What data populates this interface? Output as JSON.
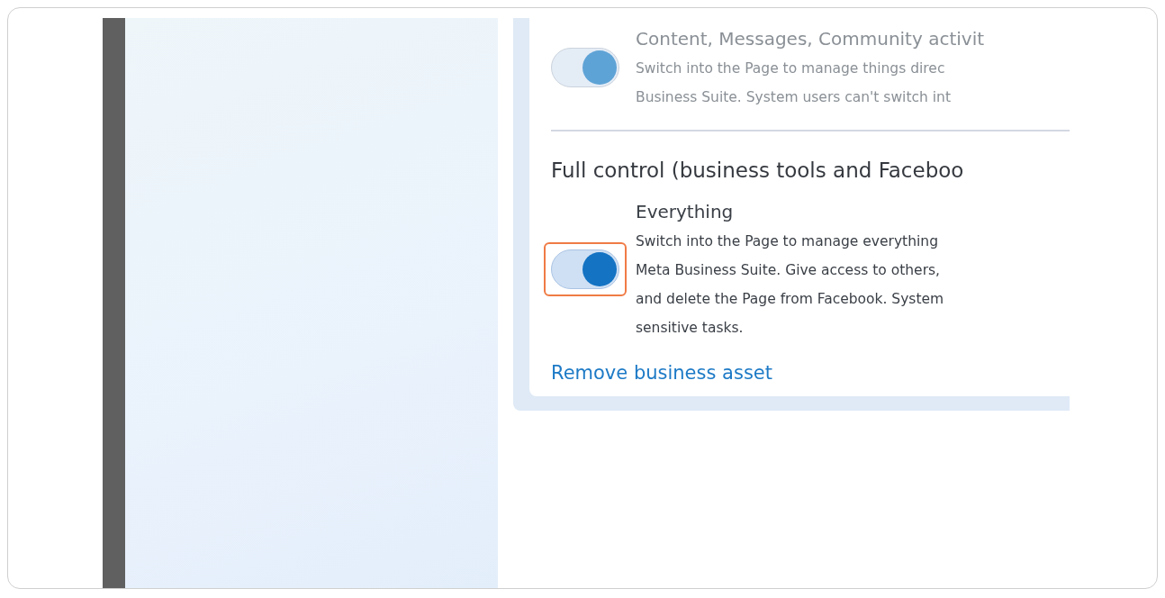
{
  "permissions": [
    {
      "title": "Content, Messages, Community activit",
      "description_lines": [
        "Switch into the Page to manage things direc",
        "Business Suite. System users can't switch int"
      ],
      "on": true,
      "disabled": true,
      "highlighted": false
    },
    {
      "heading": "Full control (business tools and Faceboo",
      "title": "Everything",
      "description_lines": [
        "Switch into the Page to manage everything",
        "Meta Business Suite. Give access to others,",
        "and delete the Page from Facebook. System",
        "sensitive tasks."
      ],
      "on": true,
      "disabled": false,
      "highlighted": true
    }
  ],
  "link": "Remove business asset"
}
